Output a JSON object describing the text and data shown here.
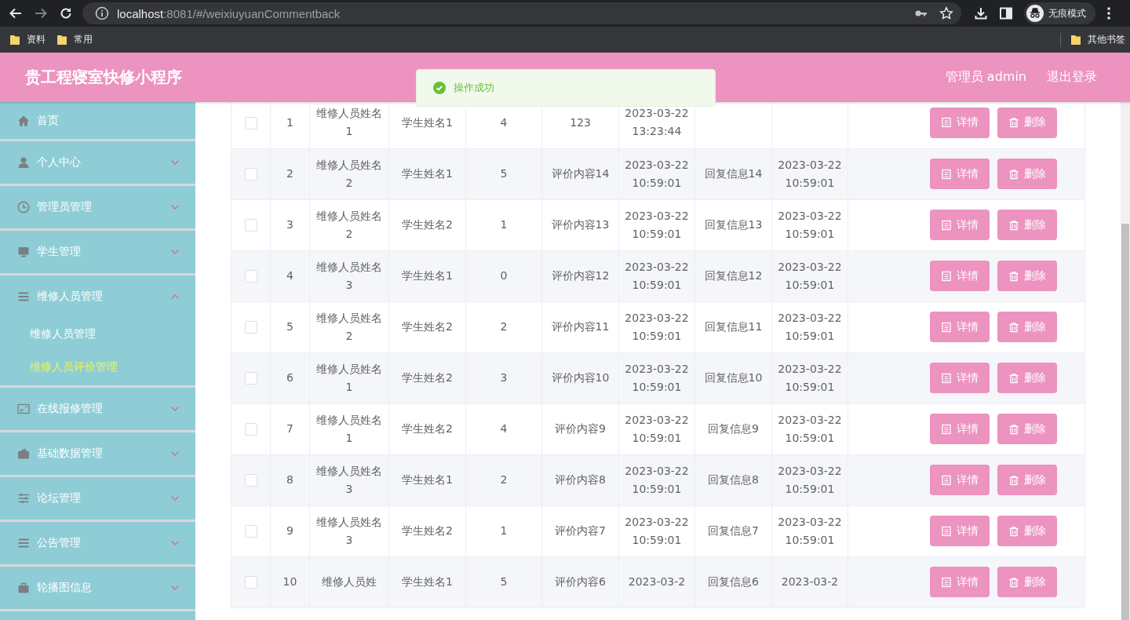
{
  "browser": {
    "url_host": "localhost",
    "url_path": ":8081/#/weixiuyuanCommentback",
    "profile_label": "无痕模式",
    "bookmarks": [
      "资料",
      "常用"
    ],
    "other_bookmarks": "其他书签"
  },
  "header": {
    "title": "贵工程寝室快修小程序",
    "user": "管理员 admin",
    "logout": "退出登录"
  },
  "toast": {
    "kind": "success",
    "text": "操作成功"
  },
  "sidebar": {
    "items": [
      {
        "label": "首页"
      },
      {
        "label": "个人中心",
        "expanded": false
      },
      {
        "label": "管理员管理",
        "expanded": false
      },
      {
        "label": "学生管理",
        "expanded": false
      },
      {
        "label": "维修人员管理",
        "expanded": true,
        "children": [
          {
            "label": "维修人员管理",
            "selected": false
          },
          {
            "label": "维修人员评价管理",
            "selected": true
          }
        ]
      },
      {
        "label": "在线报修管理",
        "expanded": false
      },
      {
        "label": "基础数据管理",
        "expanded": false
      },
      {
        "label": "论坛管理",
        "expanded": false
      },
      {
        "label": "公告管理",
        "expanded": false
      },
      {
        "label": "轮播图信息",
        "expanded": false
      }
    ]
  },
  "table": {
    "rows": [
      {
        "checked": false,
        "index": "1",
        "repairer": "维修人员姓名1",
        "student": "学生姓名1",
        "score": "4",
        "content": "123",
        "time": "2023-03-22 13:23:44",
        "actions": [
          "详情",
          "删除"
        ]
      },
      {
        "checked": false,
        "index": "2",
        "repairer": "维修人员姓名2",
        "student": "学生姓名1",
        "score": "5",
        "content": "评价内容14",
        "time": "2023-03-22 10:59:01",
        "reply": "回复信息14",
        "reply_time": "2023-03-22 10:59:01",
        "actions": [
          "详情",
          "删除"
        ]
      },
      {
        "checked": false,
        "index": "3",
        "repairer": "维修人员姓名2",
        "student": "学生姓名2",
        "score": "1",
        "content": "评价内容13",
        "time": "2023-03-22 10:59:01",
        "reply": "回复信息13",
        "reply_time": "2023-03-22 10:59:01",
        "actions": [
          "详情",
          "删除"
        ]
      },
      {
        "checked": false,
        "index": "4",
        "repairer": "维修人员姓名3",
        "student": "学生姓名1",
        "score": "0",
        "content": "评价内容12",
        "time": "2023-03-22 10:59:01",
        "reply": "回复信息12",
        "reply_time": "2023-03-22 10:59:01",
        "actions": [
          "详情",
          "删除"
        ]
      },
      {
        "checked": false,
        "index": "5",
        "repairer": "维修人员姓名2",
        "student": "学生姓名2",
        "score": "2",
        "content": "评价内容11",
        "time": "2023-03-22 10:59:01",
        "reply": "回复信息11",
        "reply_time": "2023-03-22 10:59:01",
        "actions": [
          "详情",
          "删除"
        ]
      },
      {
        "checked": false,
        "index": "6",
        "repairer": "维修人员姓名1",
        "student": "学生姓名2",
        "score": "3",
        "content": "评价内容10",
        "time": "2023-03-22 10:59:01",
        "reply": "回复信息10",
        "reply_time": "2023-03-22 10:59:01",
        "actions": [
          "详情",
          "删除"
        ]
      },
      {
        "checked": false,
        "index": "7",
        "repairer": "维修人员姓名1",
        "student": "学生姓名2",
        "score": "4",
        "content": "评价内容9",
        "time": "2023-03-22 10:59:01",
        "reply": "回复信息9",
        "reply_time": "2023-03-22 10:59:01",
        "actions": [
          "详情",
          "删除"
        ]
      },
      {
        "checked": false,
        "index": "8",
        "repairer": "维修人员姓名3",
        "student": "学生姓名1",
        "score": "2",
        "content": "评价内容8",
        "time": "2023-03-22 10:59:01",
        "reply": "回复信息8",
        "reply_time": "2023-03-22 10:59:01",
        "actions": [
          "详情",
          "删除"
        ]
      },
      {
        "checked": false,
        "index": "9",
        "repairer": "维修人员姓名3",
        "student": "学生姓名2",
        "score": "1",
        "content": "评价内容7",
        "time": "2023-03-22 10:59:01",
        "reply": "回复信息7",
        "reply_time": "2023-03-22 10:59:01",
        "actions": [
          "详情",
          "删除"
        ]
      },
      {
        "checked": false,
        "index": "10",
        "repairer": "维修人员姓",
        "student": "学生姓名1",
        "score": "5",
        "content": "评价内容6",
        "time": "2023-03-2",
        "reply": "回复信息6",
        "reply_time": "2023-03-2",
        "actions": [
          "详情",
          "删除"
        ]
      }
    ]
  }
}
